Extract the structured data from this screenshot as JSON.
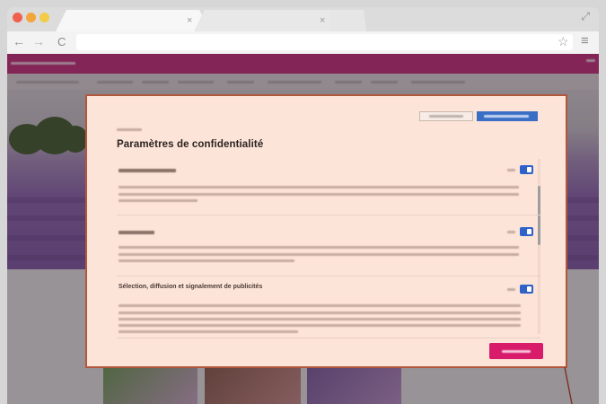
{
  "browser": {
    "address_value": "",
    "tabs": [
      {
        "title": ""
      },
      {
        "title": ""
      }
    ]
  },
  "icons": {
    "tab_close": {
      "name": "close-icon",
      "glyph": "×"
    },
    "back": {
      "name": "back-arrow-icon",
      "glyph": "←"
    },
    "forward": {
      "name": "forward-arrow-icon",
      "glyph": "→"
    },
    "reload": {
      "name": "reload-icon",
      "glyph": "C"
    },
    "star": {
      "name": "star-icon",
      "glyph": "☆"
    },
    "menu": {
      "name": "menu-icon",
      "glyph": "≡"
    },
    "expand": {
      "name": "expand-icon",
      "glyph": "⤢"
    }
  },
  "modal": {
    "title": "Paramètres de confidentialité",
    "sections": [
      {
        "heading": "",
        "enabled": true
      },
      {
        "heading": "",
        "enabled": true
      },
      {
        "heading": "Sélection, diffusion et signalement de publicités",
        "enabled": true
      }
    ]
  },
  "colors": {
    "modal_background": "#fde4d8",
    "modal_border": "#b3573c",
    "toggle_on": "#2f62c9",
    "accept_button": "#3a6dc4",
    "save_button": "#d81b6a",
    "site_header": "#c42a7c"
  }
}
